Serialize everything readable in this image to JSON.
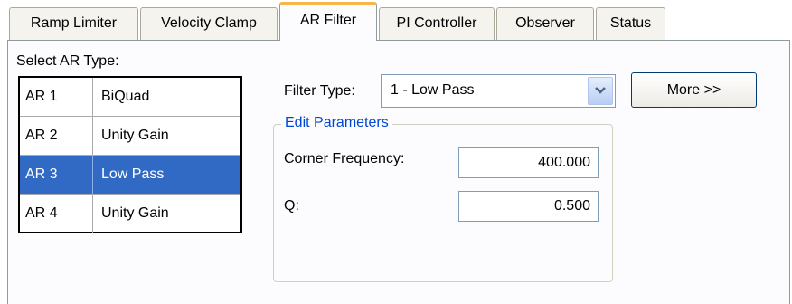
{
  "tabs": [
    {
      "label": "Ramp Limiter"
    },
    {
      "label": "Velocity Clamp"
    },
    {
      "label": "AR Filter"
    },
    {
      "label": "PI Controller"
    },
    {
      "label": "Observer"
    },
    {
      "label": "Status"
    }
  ],
  "active_tab": "AR Filter",
  "ar_select": {
    "label": "Select AR Type:",
    "rows": [
      {
        "id": "AR 1",
        "type": "BiQuad"
      },
      {
        "id": "AR 2",
        "type": "Unity Gain"
      },
      {
        "id": "AR 3",
        "type": "Low Pass"
      },
      {
        "id": "AR 4",
        "type": "Unity Gain"
      }
    ],
    "selected": "AR 3"
  },
  "filter_type": {
    "label": "Filter Type:",
    "value": "1 - Low Pass"
  },
  "more_button": {
    "label": "More >>"
  },
  "edit_parameters": {
    "legend": "Edit Parameters",
    "corner_frequency": {
      "label": "Corner Frequency:",
      "value": "400.000"
    },
    "q": {
      "label": "Q:",
      "value": "0.500"
    }
  },
  "colors": {
    "selection": "#316ac5",
    "active_tab_accent": "#f7b64a",
    "group_legend": "#0046d5"
  }
}
